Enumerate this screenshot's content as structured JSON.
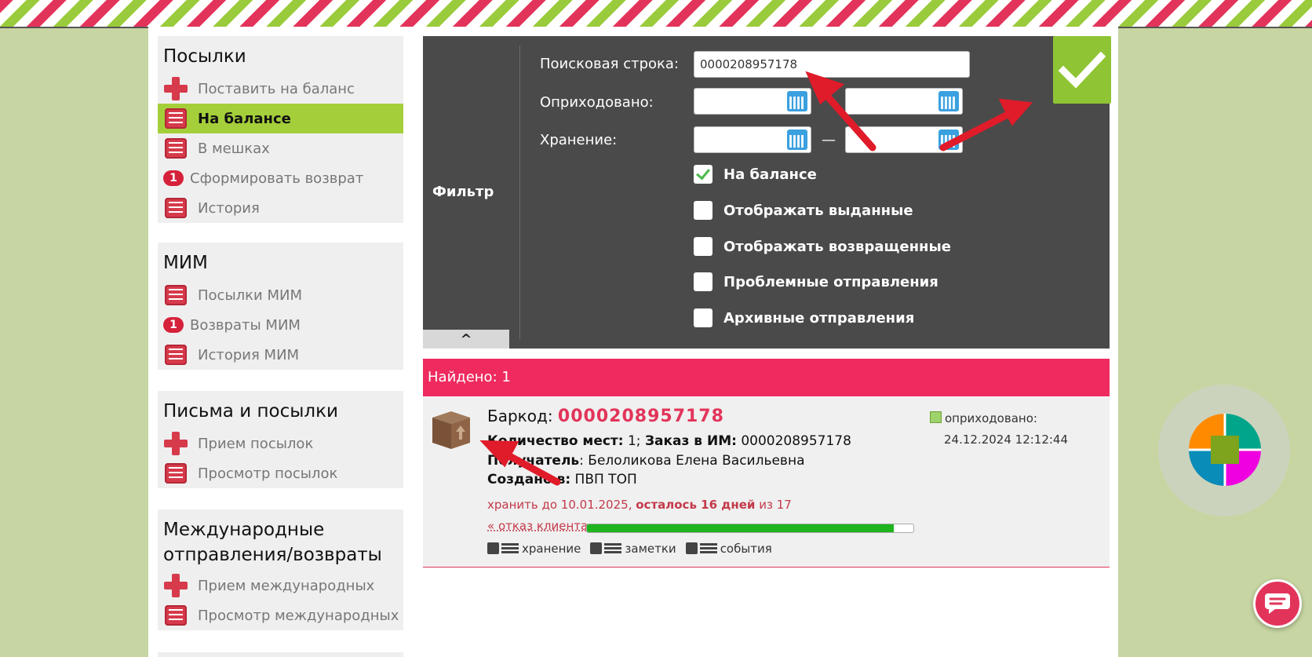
{
  "sidebar": {
    "parcels": {
      "title": "Посылки",
      "items": [
        {
          "label": "Поставить на баланс",
          "icon": "plus-icon"
        },
        {
          "label": "На балансе",
          "icon": "list-icon",
          "active": true
        },
        {
          "label": "В мешках",
          "icon": "list-icon"
        },
        {
          "label": "Сформировать возврат",
          "badge": "1"
        },
        {
          "label": "История",
          "icon": "list-icon"
        }
      ]
    },
    "mim": {
      "title": "МИМ",
      "items": [
        {
          "label": "Посылки МИМ",
          "icon": "list-icon"
        },
        {
          "label": "Возвраты МИМ",
          "badge": "1"
        },
        {
          "label": "История МИМ",
          "icon": "list-icon"
        }
      ]
    },
    "letters": {
      "title": "Письма и посылки",
      "items": [
        {
          "label": "Прием посылок",
          "icon": "plus-icon"
        },
        {
          "label": "Просмотр посылок",
          "icon": "list-icon"
        }
      ]
    },
    "intl": {
      "title_line1": "Международные",
      "title_line2": "отправления/возвраты",
      "items": [
        {
          "label": "Прием международных",
          "icon": "plus-icon"
        },
        {
          "label": "Просмотр международных",
          "icon": "list-icon"
        }
      ]
    }
  },
  "filter": {
    "label": "Фильтр",
    "search_label": "Поисковая строка:",
    "search_value": "0000208957178",
    "received_label": "Оприходовано:",
    "storage_label": "Хранение:",
    "range_dash": "—",
    "checkboxes": [
      {
        "label": "На балансе",
        "checked": true
      },
      {
        "label": "Отображать выданные",
        "checked": false
      },
      {
        "label": "Отображать возвращенные",
        "checked": false
      },
      {
        "label": "Проблемные отправления",
        "checked": false
      },
      {
        "label": "Архивные отправления",
        "checked": false
      }
    ],
    "collapse_glyph": "^"
  },
  "results": {
    "found_text": "Найдено: 1",
    "item": {
      "barcode_label": "Баркод:",
      "barcode": "0000208957178",
      "places_label": "Количество мест:",
      "places_value": "1;",
      "order_label": "Заказ в ИМ:",
      "order_value": "0000208957178",
      "recipient_label": "Получатель",
      "recipient_value": ": Белоликова Елена Васильевна",
      "created_label": "Создано в:",
      "created_value": "ПВП ТОП",
      "keep_until": "хранить до 10.01.2025,",
      "remaining": "осталось 16  дней",
      "of_total": "из 17",
      "storage_progress": 0.94,
      "refuse_link": "« отказ клиента",
      "tabs": [
        "хранение",
        "заметки",
        "события"
      ],
      "status_label": "оприходовано:",
      "status_date": "24.12.2024 12:12:44"
    }
  },
  "colors": {
    "accent_green": "#a4cf3a",
    "accent_pink": "#ee2a5e",
    "panel_dark": "#4a4a4a"
  }
}
